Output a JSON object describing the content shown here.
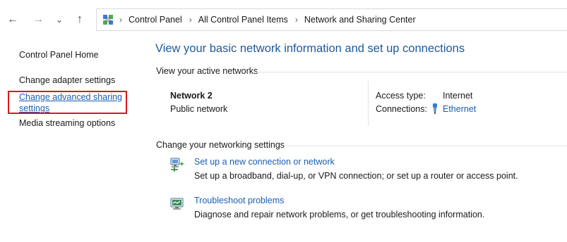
{
  "nav": {
    "back_glyph": "←",
    "forward_glyph": "→",
    "recent_glyph": "⌄",
    "up_glyph": "↑"
  },
  "address_bar": {
    "crumbs": [
      "Control Panel",
      "All Control Panel Items",
      "Network and Sharing Center"
    ],
    "separator": "›"
  },
  "sidebar": {
    "items": [
      {
        "label": "Control Panel Home"
      },
      {
        "label": "Change adapter settings"
      },
      {
        "label": "Change advanced sharing settings"
      },
      {
        "label": "Media streaming options"
      }
    ]
  },
  "main": {
    "title": "View your basic network information and set up connections",
    "active_networks": {
      "heading": "View your active networks",
      "network_name": "Network 2",
      "network_type": "Public network",
      "access_type_label": "Access type:",
      "access_type_value": "Internet",
      "connections_label": "Connections:",
      "connection_name": "Ethernet"
    },
    "networking_settings": {
      "heading": "Change your networking settings",
      "tasks": [
        {
          "title": "Set up a new connection or network",
          "description": "Set up a broadband, dial-up, or VPN connection; or set up a router or access point."
        },
        {
          "title": "Troubleshoot problems",
          "description": "Diagnose and repair network problems, or get troubleshooting information."
        }
      ]
    }
  },
  "colors": {
    "title_blue": "#1c5a9c",
    "link_blue": "#1a5fb4",
    "highlight_red": "#e0141e"
  }
}
